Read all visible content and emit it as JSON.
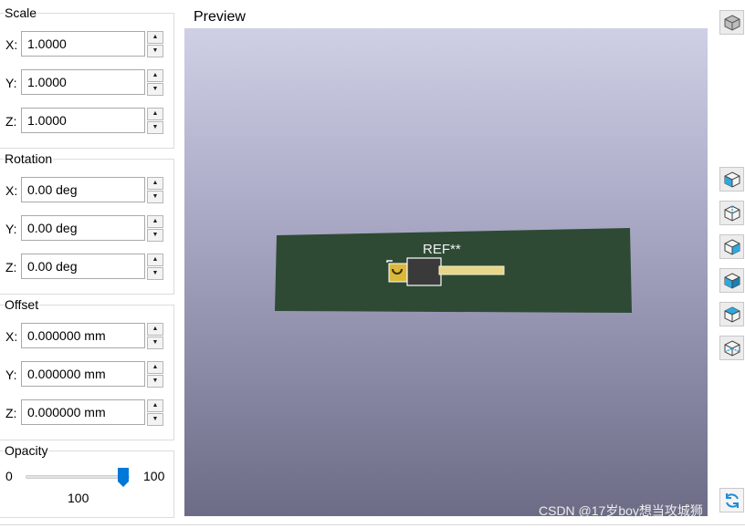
{
  "scale": {
    "title": "Scale",
    "fields": [
      {
        "label": "X:",
        "value": "1.0000"
      },
      {
        "label": "Y:",
        "value": "1.0000"
      },
      {
        "label": "Z:",
        "value": "1.0000"
      }
    ]
  },
  "rotation": {
    "title": "Rotation",
    "fields": [
      {
        "label": "X:",
        "value": "0.00 deg"
      },
      {
        "label": "Y:",
        "value": "0.00 deg"
      },
      {
        "label": "Z:",
        "value": "0.00 deg"
      }
    ]
  },
  "offset": {
    "title": "Offset",
    "fields": [
      {
        "label": "X:",
        "value": "0.000000 mm"
      },
      {
        "label": "Y:",
        "value": "0.000000 mm"
      },
      {
        "label": "Z:",
        "value": "0.000000 mm"
      }
    ]
  },
  "opacity": {
    "title": "Opacity",
    "min": "0",
    "max": "100",
    "value": "100",
    "fraction": 1.0
  },
  "preview": {
    "title": "Preview",
    "ref_label": "REF**",
    "board_color": "#2e4a34",
    "pin_color": "#e7d58a",
    "body_color": "#3a3a3a"
  },
  "view_buttons": [
    "view-3d-icon",
    "view-front-icon",
    "view-back-icon",
    "view-left-icon",
    "view-right-icon",
    "view-top-icon",
    "view-bottom-icon",
    "reload-icon"
  ],
  "watermark": "CSDN @17岁boy想当攻城狮"
}
